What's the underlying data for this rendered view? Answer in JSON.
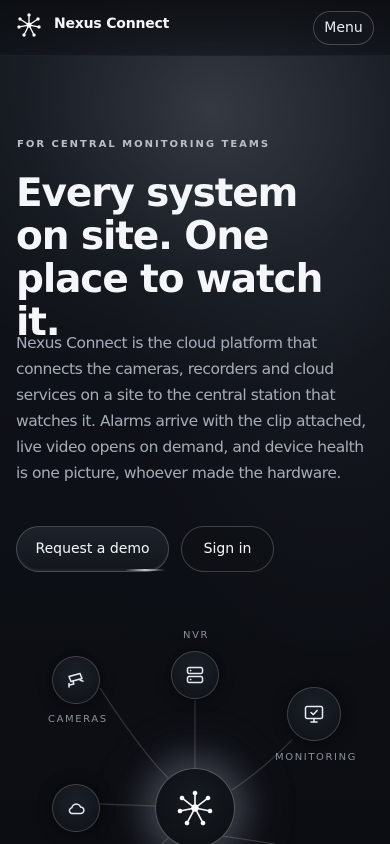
{
  "header": {
    "brand": "Nexus Connect",
    "menu_label": "Menu"
  },
  "hero": {
    "eyebrow": "FOR CENTRAL MONITORING TEAMS",
    "headline": "Every system on site. One place to watch it.",
    "lede": "Nexus Connect is the cloud platform that connects the cameras, recorders and cloud services on a site to the central station that watches it. Alarms arrive with the clip attached, live video opens on demand, and device health is one picture, whoever made the hardware.",
    "primary_cta": "Request a demo",
    "secondary_cta": "Sign in"
  },
  "diagram": {
    "nodes": [
      {
        "label": "NVR",
        "icon": "server-icon"
      },
      {
        "label": "CAMERAS",
        "icon": "camera-icon"
      },
      {
        "label": "MONITORING",
        "icon": "monitor-icon"
      },
      {
        "label": "",
        "icon": "cloud-icon"
      }
    ],
    "hub_icon": "network-hub-icon"
  }
}
